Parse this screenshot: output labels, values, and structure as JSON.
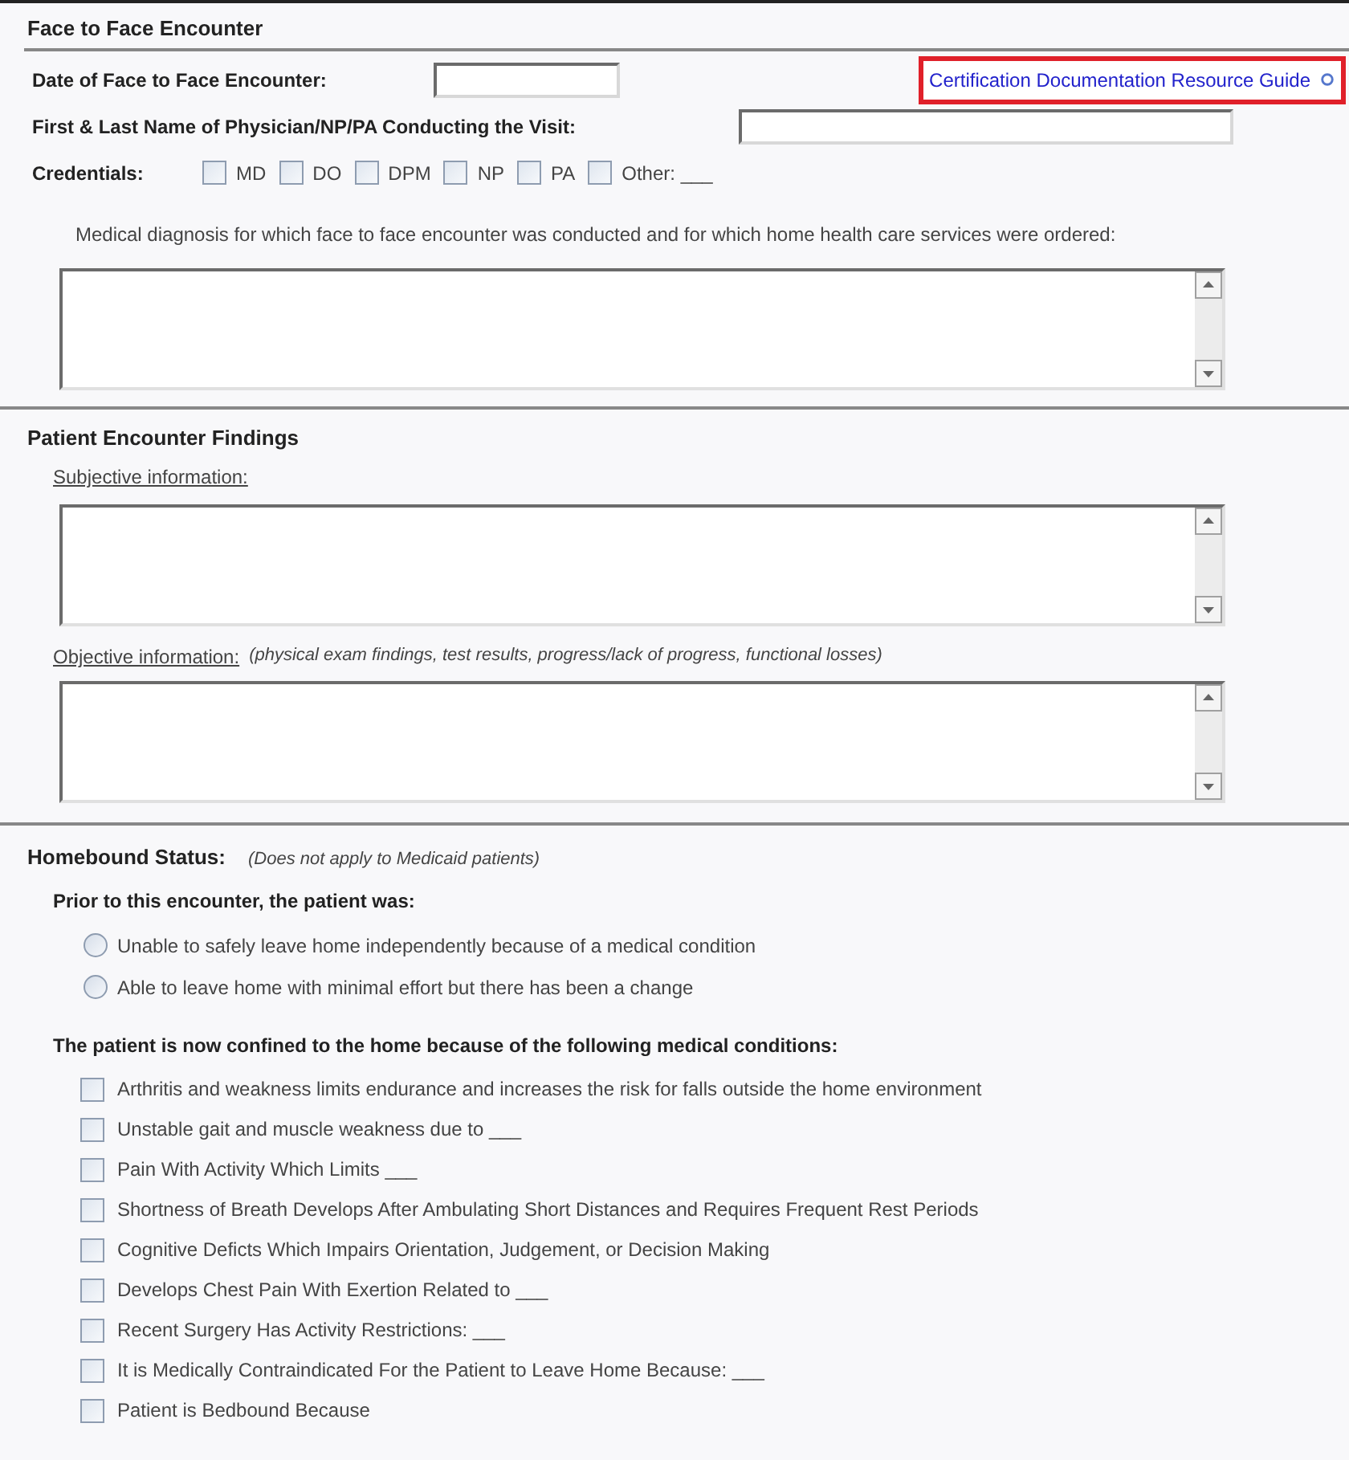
{
  "encounter": {
    "title": "Face to Face Encounter",
    "date_label": "Date of Face to Face Encounter:",
    "resource_link": "Certification Documentation Resource Guide",
    "physician_label": "First & Last Name of Physician/NP/PA Conducting the Visit:",
    "credentials_label": "Credentials:",
    "credentials": [
      {
        "label": "MD",
        "checked": false
      },
      {
        "label": "DO",
        "checked": false
      },
      {
        "label": "DPM",
        "checked": false
      },
      {
        "label": "NP",
        "checked": false
      },
      {
        "label": "PA",
        "checked": false
      },
      {
        "label": "Other: ___",
        "checked": false
      }
    ],
    "diagnosis_prompt": "Medical diagnosis for which face to face encounter was conducted and for which home health care services were ordered:"
  },
  "findings": {
    "title": "Patient Encounter Findings",
    "subjective_label": "Subjective information:",
    "objective_label": "Objective information:",
    "objective_hint": "(physical exam findings, test results, progress/lack of progress, functional losses)"
  },
  "homebound": {
    "title": "Homebound Status:",
    "note": "(Does not apply to Medicaid patients)",
    "prior_label": "Prior to this encounter, the patient was:",
    "prior_options": [
      {
        "label": "Unable to safely leave home independently because of a medical condition",
        "selected": false
      },
      {
        "label": "Able to leave home with minimal effort but there has been a change",
        "selected": false
      }
    ],
    "conditions_label": "The patient is now confined to the home because of the following medical conditions:",
    "conditions": [
      {
        "label": "Arthritis and weakness limits endurance and increases the risk for falls outside the home environment",
        "checked": false
      },
      {
        "label": "Unstable gait and muscle weakness due to ___",
        "checked": false
      },
      {
        "label": "Pain With Activity Which Limits ___",
        "checked": false
      },
      {
        "label": "Shortness of Breath Develops After Ambulating Short Distances and Requires Frequent Rest Periods",
        "checked": false
      },
      {
        "label": "Cognitive Deficts Which Impairs Orientation, Judgement, or Decision Making",
        "checked": false
      },
      {
        "label": "Develops Chest Pain With Exertion Related to ___",
        "checked": false
      },
      {
        "label": "Recent Surgery Has Activity Restrictions: ___",
        "checked": false
      },
      {
        "label": "It is Medically Contraindicated For the Patient to Leave Home Because: ___",
        "checked": false
      },
      {
        "label": "Patient is Bedbound Because",
        "checked": false
      }
    ]
  }
}
